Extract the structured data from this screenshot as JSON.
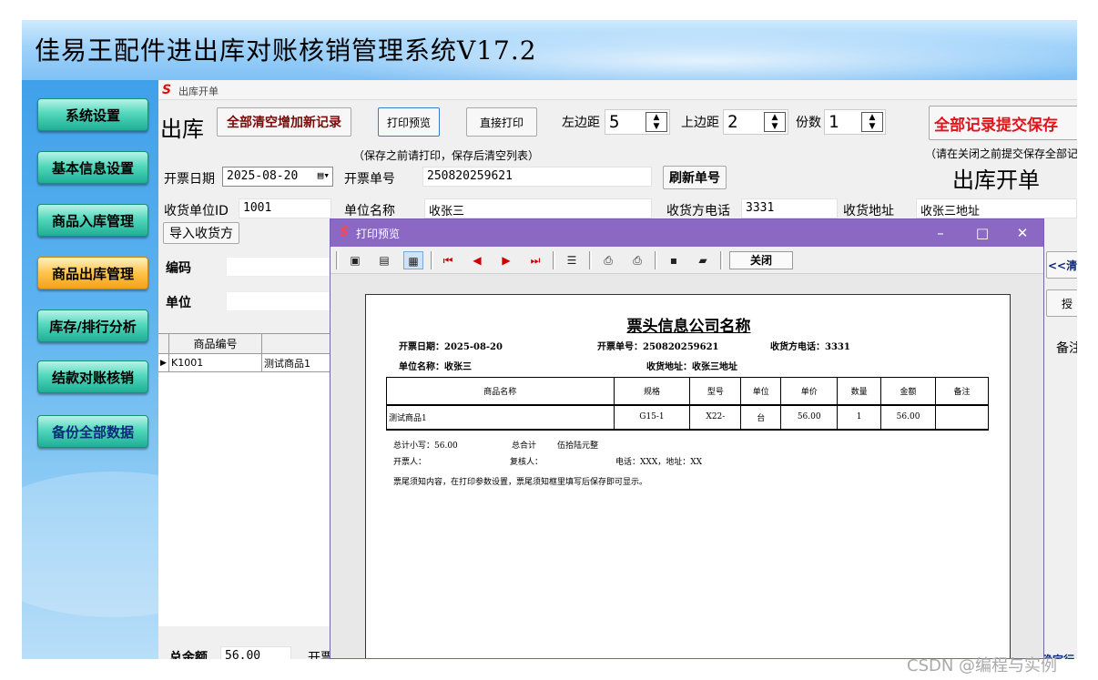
{
  "app": {
    "title": "佳易王配件进出库对账核销管理系统V17.2"
  },
  "sidebar": {
    "items": [
      {
        "label": "系统设置"
      },
      {
        "label": "基本信息设置"
      },
      {
        "label": "商品入库管理"
      },
      {
        "label": "商品出库管理"
      },
      {
        "label": "库存/排行分析"
      },
      {
        "label": "结款对账核销"
      },
      {
        "label": "备份全部数据"
      }
    ],
    "active_index": 3
  },
  "form": {
    "window_caption": "出库开单",
    "heading": "出库",
    "clear_add_label": "全部清空增加新记录",
    "print_preview_label": "打印预览",
    "direct_print_label": "直接打印",
    "note_left": "（保存之前请打印，保存后清空列表）",
    "left_margin_label": "左边距",
    "left_margin_value": "5",
    "top_margin_label": "上边距",
    "top_margin_value": "2",
    "copies_label": "份数",
    "copies_value": "1",
    "submit_label": "全部记录提交保存",
    "note_right": "（请在关闭之前提交保存全部记录",
    "big_title": "出库开单",
    "date_label": "开票日期",
    "date_value": "2025-08-20",
    "ticket_no_label": "开票单号",
    "ticket_no_value": "250820259621",
    "refresh_label": "刷新单号",
    "receiver_id_label": "收货单位ID",
    "receiver_id_value": "1001",
    "unit_name_label": "单位名称",
    "unit_name_value": "收张三",
    "receiver_phone_label": "收货方电话",
    "receiver_phone_value": "3331",
    "receiver_addr_label": "收货地址",
    "receiver_addr_value": "收张三地址",
    "import_label": "导入收货方",
    "code_label": "编码",
    "unit_label": "单位",
    "clear_btn_label": "<<清",
    "auth_btn_label": "授",
    "remark_col_label": "备注",
    "total_label": "总金额",
    "total_value": "56.00",
    "next_label": "开票",
    "confirm_label": "确定行"
  },
  "grid": {
    "columns": [
      "商品编号",
      ""
    ],
    "rows": [
      [
        "K1001",
        "测试商品1"
      ]
    ]
  },
  "preview": {
    "title": "打印预览",
    "close_label": "关闭",
    "company": "票头信息公司名称",
    "date_text": "开票日期：2025-08-20",
    "no_text": "开票单号：250820259621",
    "phone_text": "收货方电话：3331",
    "unit_text": "单位名称：收张三",
    "addr_text": "收货地址：收张三地址",
    "headers": [
      "商品名称",
      "规格",
      "型号",
      "单位",
      "单价",
      "数量",
      "金额",
      "备注"
    ],
    "row": [
      "测试商品1",
      "G15-1",
      "X22-",
      "台",
      "56.00",
      "1",
      "56.00",
      ""
    ],
    "subtotal_text": "总计小写：56.00",
    "total_text": "总合计",
    "upper_text": "伍拾陆元整",
    "issuer_text": "开票人：",
    "checker_text": "复核人：",
    "contact_text": "电话：XXX，地址：XX",
    "footer_text": "票尾须知内容，在打印参数设置，票尾须知框里填写后保存即可显示。"
  },
  "watermark": "CSDN @编程与实例",
  "colors": {
    "accent_purple": "#8a68c3",
    "submit_red": "#e0141a",
    "nav_teal": "#1fae95",
    "nav_active": "#f2a21b"
  }
}
